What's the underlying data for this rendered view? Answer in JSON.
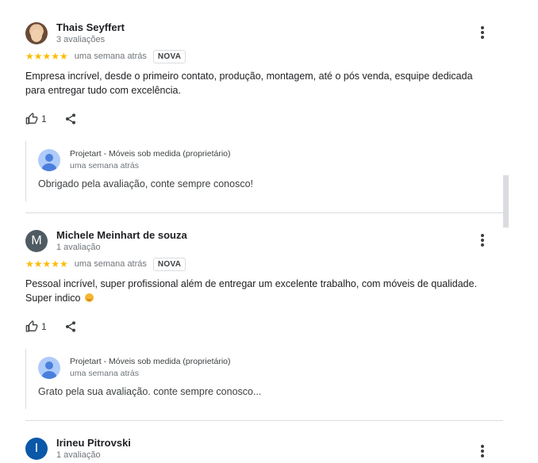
{
  "reviews": [
    {
      "author": "Thais Seyffert",
      "review_count": "3 avaliações",
      "avatar_type": "photo",
      "rating": 5,
      "stars": "★★★★★",
      "time": "uma semana atrás",
      "badge": "NOVA",
      "text": "Empresa incrível, desde o primeiro contato, produção, montagem, até o pós venda, esquipe dedicada para entregar tudo com excelência.",
      "likes": "1",
      "reply": {
        "owner": "Projetart - Móveis sob medida (proprietário)",
        "time": "uma semana atrás",
        "text": "Obrigado pela avaliação, conte sempre conosco!"
      }
    },
    {
      "author": "Michele Meinhart de souza",
      "review_count": "1 avaliação",
      "avatar_letter": "M",
      "avatar_color": "#4f5b62",
      "rating": 5,
      "stars": "★★★★★",
      "time": "uma semana atrás",
      "badge": "NOVA",
      "text": "Pessoal incrível, super profissional além de entregar um excelente trabalho, com móveis de qualidade. Super indico",
      "emoji": "smiling-face-icon",
      "likes": "1",
      "reply": {
        "owner": "Projetart - Móveis sob medida (proprietário)",
        "time": "uma semana atrás",
        "text": "Grato pela sua avaliação. conte sempre conosco..."
      }
    },
    {
      "author": "Irineu Pitrovski",
      "review_count": "1 avaliação",
      "avatar_letter": "I",
      "avatar_color": "#0b57a8"
    }
  ],
  "colors": {
    "star": "#fbbc04",
    "divider": "#dadce0",
    "owner_avatar": "#aecbfa"
  }
}
